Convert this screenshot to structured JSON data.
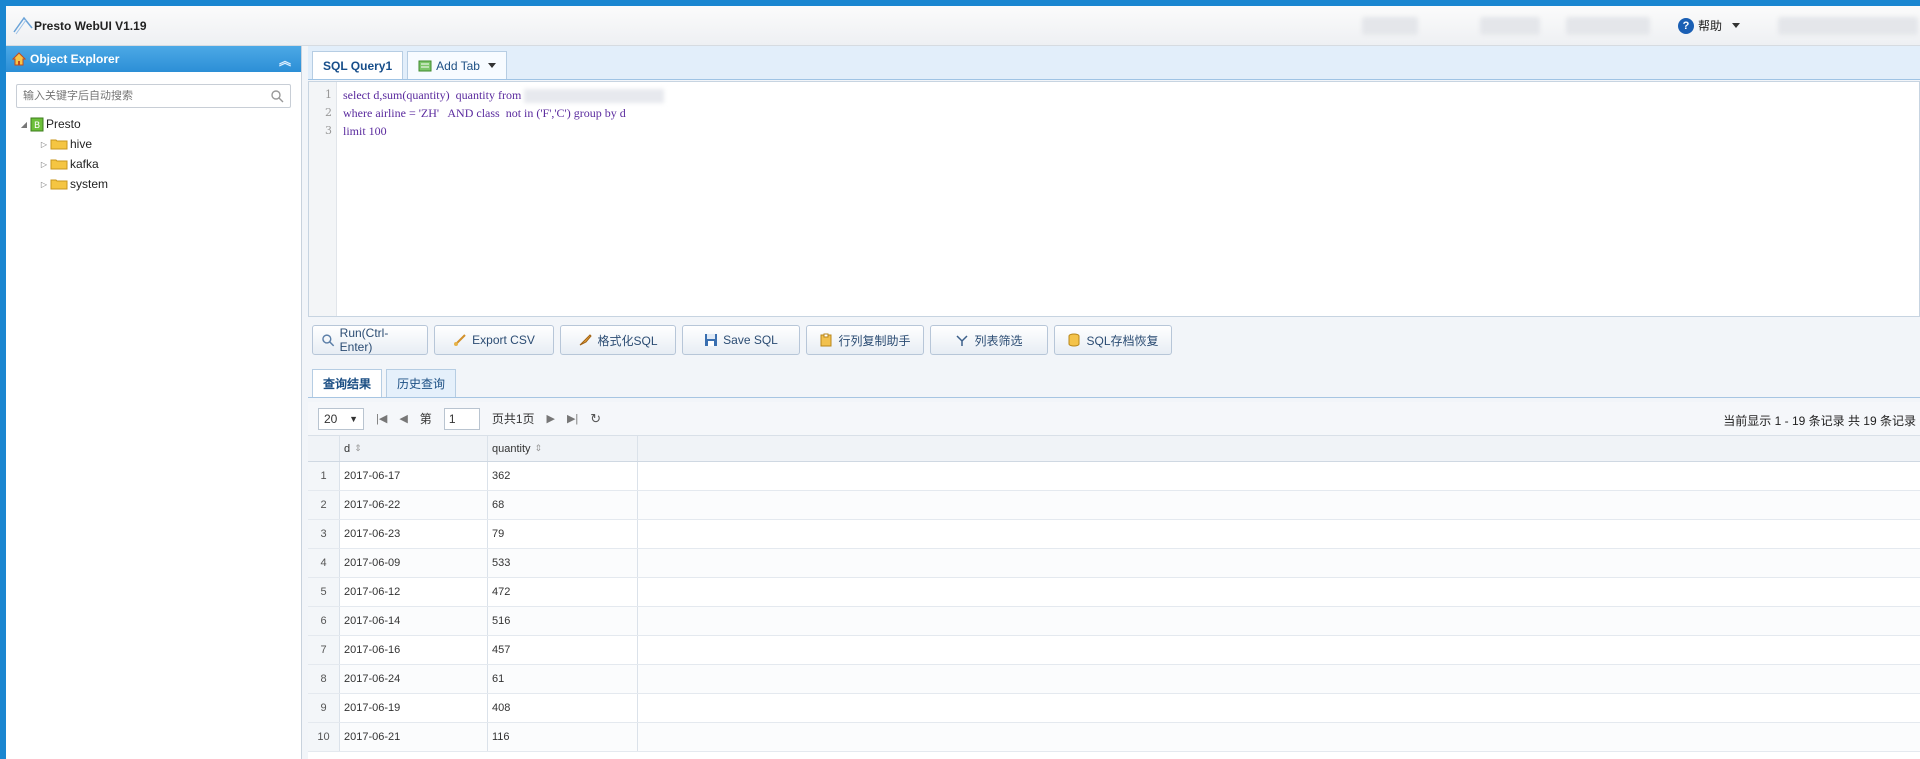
{
  "app": {
    "title": "Presto WebUI V1.19"
  },
  "header": {
    "help_label": "帮助"
  },
  "sidebar": {
    "title": "Object Explorer",
    "search_placeholder": "输入关键字后自动搜索",
    "tree": {
      "root": "Presto",
      "children": [
        "hive",
        "kafka",
        "system"
      ]
    }
  },
  "tabs": [
    {
      "label": "SQL Query1"
    },
    {
      "label": "Add Tab"
    }
  ],
  "editor": {
    "lines": [
      {
        "num": "1",
        "text": "select d,sum(quantity)  quantity from "
      },
      {
        "num": "2",
        "text": "where airline = 'ZH'   AND class  not in ('F','C') group by d"
      },
      {
        "num": "3",
        "text": "limit 100"
      }
    ]
  },
  "toolbar": {
    "run": "Run(Ctrl-Enter)",
    "export": "Export CSV",
    "format": "格式化SQL",
    "save": "Save SQL",
    "copy": "行列复制助手",
    "filter": "列表筛选",
    "archive": "SQL存档恢复"
  },
  "result_tabs": {
    "results": "查询结果",
    "history": "历史查询"
  },
  "pager": {
    "page_size": "20",
    "page_prefix": "第",
    "page_value": "1",
    "page_suffix": "页共1页",
    "info": "当前显示 1 - 19 条记录 共 19 条记录"
  },
  "grid": {
    "columns": [
      "d",
      "quantity"
    ],
    "rows": [
      {
        "n": "1",
        "d": "2017-06-17",
        "q": "362"
      },
      {
        "n": "2",
        "d": "2017-06-22",
        "q": "68"
      },
      {
        "n": "3",
        "d": "2017-06-23",
        "q": "79"
      },
      {
        "n": "4",
        "d": "2017-06-09",
        "q": "533"
      },
      {
        "n": "5",
        "d": "2017-06-12",
        "q": "472"
      },
      {
        "n": "6",
        "d": "2017-06-14",
        "q": "516"
      },
      {
        "n": "7",
        "d": "2017-06-16",
        "q": "457"
      },
      {
        "n": "8",
        "d": "2017-06-24",
        "q": "61"
      },
      {
        "n": "9",
        "d": "2017-06-19",
        "q": "408"
      },
      {
        "n": "10",
        "d": "2017-06-21",
        "q": "116"
      }
    ]
  }
}
